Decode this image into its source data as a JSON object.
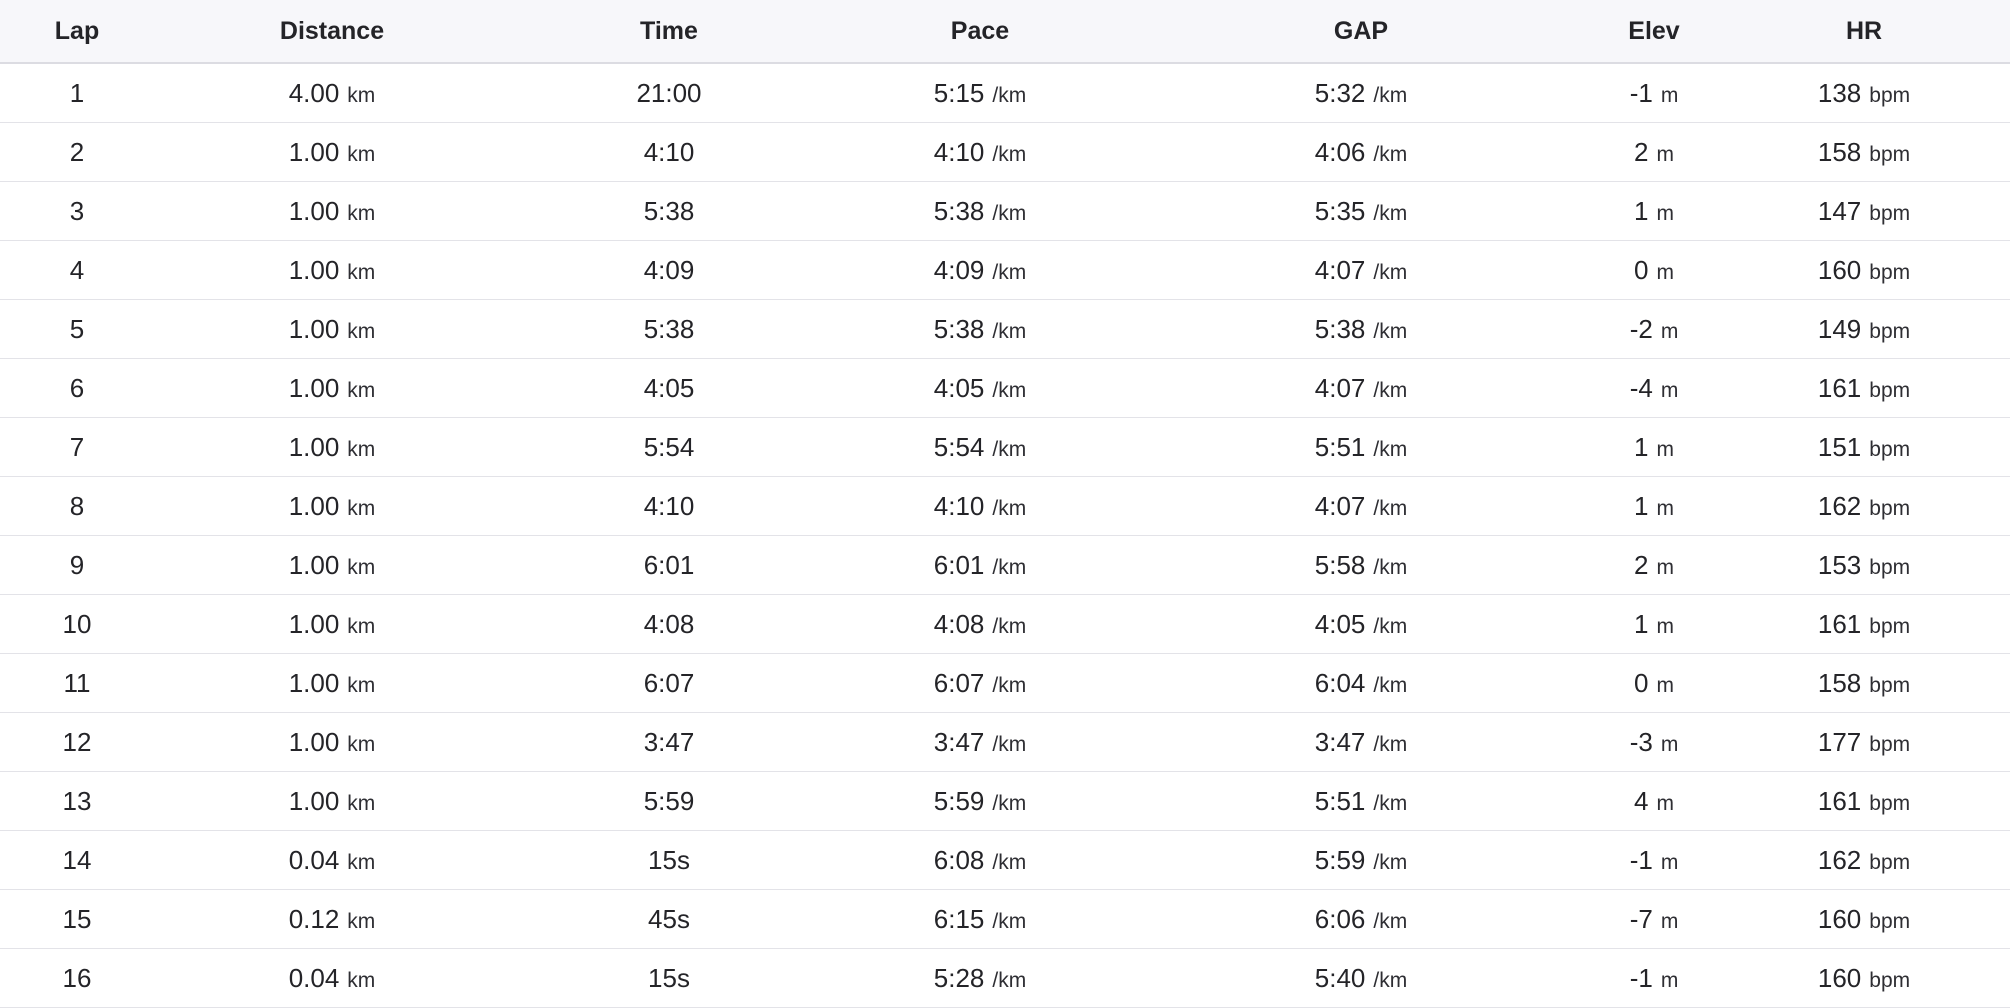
{
  "table": {
    "headers": {
      "lap": "Lap",
      "distance": "Distance",
      "time": "Time",
      "pace": "Pace",
      "gap": "GAP",
      "elev": "Elev",
      "hr": "HR"
    },
    "units": {
      "distance": "km",
      "pace": "/km",
      "gap": "/km",
      "elev": "m",
      "hr": "bpm"
    },
    "rows": [
      {
        "lap": "1",
        "distance": "4.00",
        "time": "21:00",
        "pace": "5:15",
        "gap": "5:32",
        "elev": "-1",
        "hr": "138"
      },
      {
        "lap": "2",
        "distance": "1.00",
        "time": "4:10",
        "pace": "4:10",
        "gap": "4:06",
        "elev": "2",
        "hr": "158"
      },
      {
        "lap": "3",
        "distance": "1.00",
        "time": "5:38",
        "pace": "5:38",
        "gap": "5:35",
        "elev": "1",
        "hr": "147"
      },
      {
        "lap": "4",
        "distance": "1.00",
        "time": "4:09",
        "pace": "4:09",
        "gap": "4:07",
        "elev": "0",
        "hr": "160"
      },
      {
        "lap": "5",
        "distance": "1.00",
        "time": "5:38",
        "pace": "5:38",
        "gap": "5:38",
        "elev": "-2",
        "hr": "149"
      },
      {
        "lap": "6",
        "distance": "1.00",
        "time": "4:05",
        "pace": "4:05",
        "gap": "4:07",
        "elev": "-4",
        "hr": "161"
      },
      {
        "lap": "7",
        "distance": "1.00",
        "time": "5:54",
        "pace": "5:54",
        "gap": "5:51",
        "elev": "1",
        "hr": "151"
      },
      {
        "lap": "8",
        "distance": "1.00",
        "time": "4:10",
        "pace": "4:10",
        "gap": "4:07",
        "elev": "1",
        "hr": "162"
      },
      {
        "lap": "9",
        "distance": "1.00",
        "time": "6:01",
        "pace": "6:01",
        "gap": "5:58",
        "elev": "2",
        "hr": "153"
      },
      {
        "lap": "10",
        "distance": "1.00",
        "time": "4:08",
        "pace": "4:08",
        "gap": "4:05",
        "elev": "1",
        "hr": "161"
      },
      {
        "lap": "11",
        "distance": "1.00",
        "time": "6:07",
        "pace": "6:07",
        "gap": "6:04",
        "elev": "0",
        "hr": "158"
      },
      {
        "lap": "12",
        "distance": "1.00",
        "time": "3:47",
        "pace": "3:47",
        "gap": "3:47",
        "elev": "-3",
        "hr": "177"
      },
      {
        "lap": "13",
        "distance": "1.00",
        "time": "5:59",
        "pace": "5:59",
        "gap": "5:51",
        "elev": "4",
        "hr": "161"
      },
      {
        "lap": "14",
        "distance": "0.04",
        "time": "15s",
        "pace": "6:08",
        "gap": "5:59",
        "elev": "-1",
        "hr": "162"
      },
      {
        "lap": "15",
        "distance": "0.12",
        "time": "45s",
        "pace": "6:15",
        "gap": "6:06",
        "elev": "-7",
        "hr": "160"
      },
      {
        "lap": "16",
        "distance": "0.04",
        "time": "15s",
        "pace": "5:28",
        "gap": "5:40",
        "elev": "-1",
        "hr": "160"
      }
    ]
  }
}
